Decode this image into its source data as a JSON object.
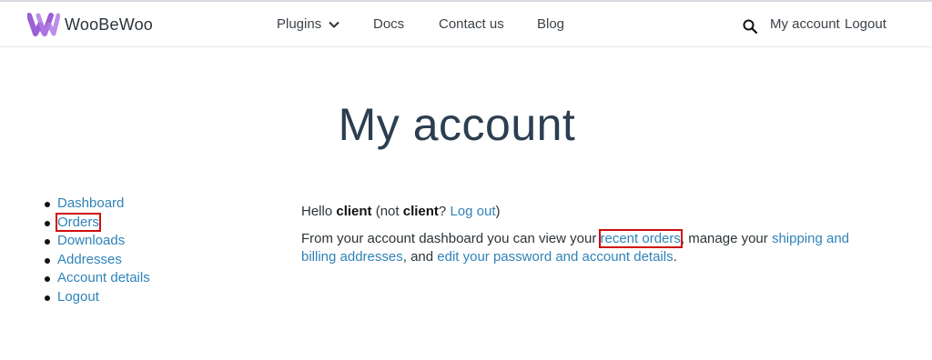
{
  "colors": {
    "brand": "#9b5fd6",
    "link": "#2f83b8",
    "highlight": "#d10d0d",
    "heading": "#2c3e50"
  },
  "header": {
    "brand": "WooBeWoo",
    "nav": {
      "plugins": "Plugins",
      "docs": "Docs",
      "contact": "Contact us",
      "blog": "Blog"
    },
    "icons": {
      "logo": "woobewoo-logo",
      "plugins_caret": "chevron-down-icon",
      "search": "search-icon"
    },
    "my_account": "My account",
    "logout": "Logout"
  },
  "page_title": "My account",
  "account_nav": [
    {
      "label": "Dashboard",
      "highlighted": false
    },
    {
      "label": "Orders",
      "highlighted": true
    },
    {
      "label": "Downloads",
      "highlighted": false
    },
    {
      "label": "Addresses",
      "highlighted": false
    },
    {
      "label": "Account details",
      "highlighted": false
    },
    {
      "label": "Logout",
      "highlighted": false
    }
  ],
  "content": {
    "hello": "Hello ",
    "username": "client",
    "not": " (not ",
    "username2": "client",
    "question": "? ",
    "logout_link": "Log out",
    "close_paren": ")",
    "dash_text_1": "From your account dashboard you can view your ",
    "recent_orders": "recent orders",
    "dash_text_2": ", manage your ",
    "shipping_link": "shipping and billing addresses",
    "dash_text_3": ", and ",
    "edit_link": "edit your password and account details",
    "dash_text_4": "."
  }
}
